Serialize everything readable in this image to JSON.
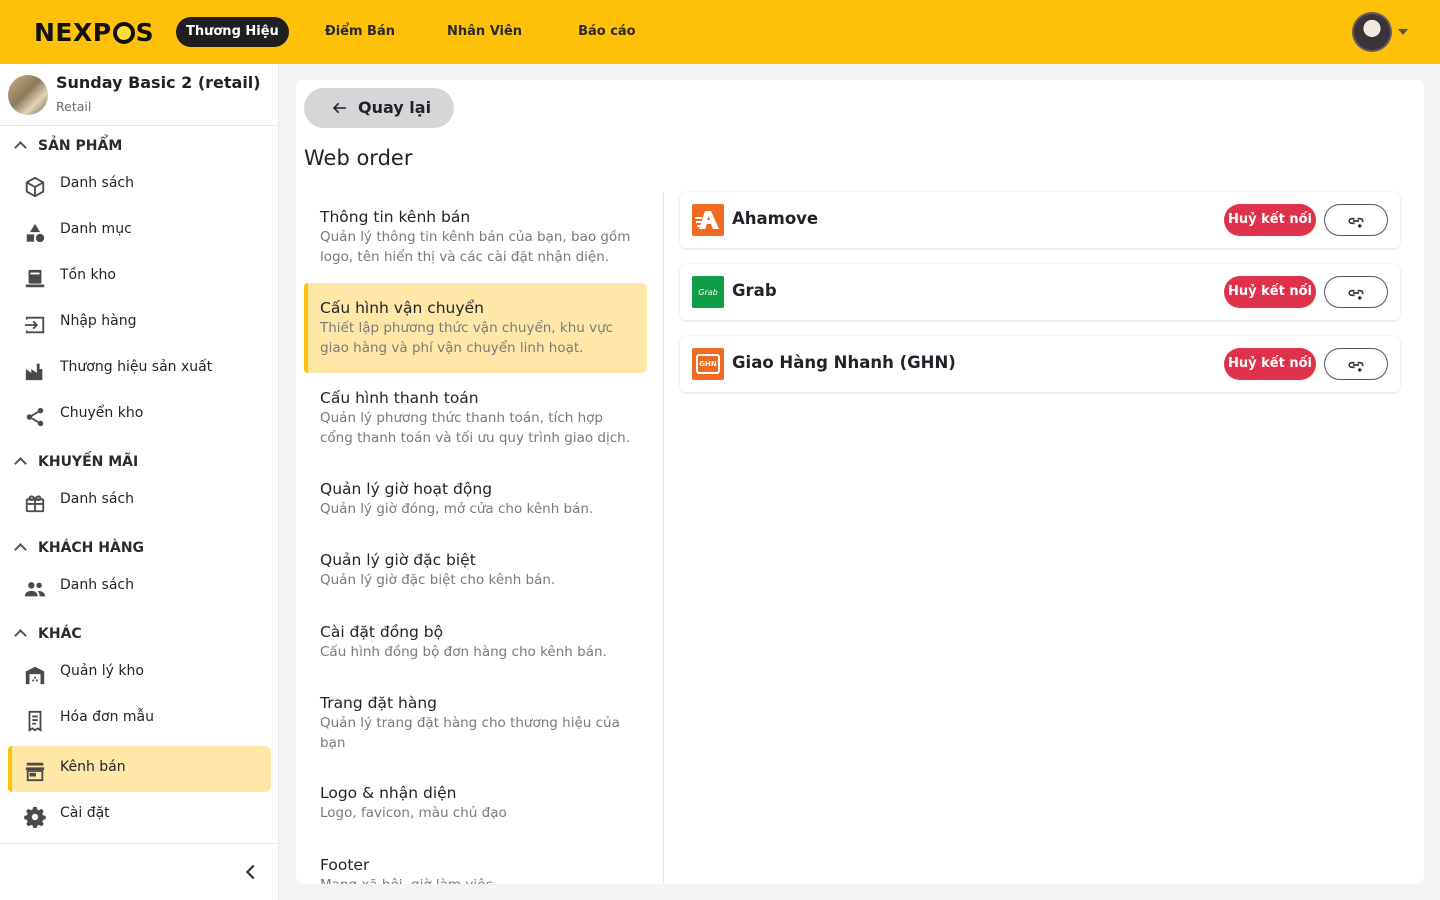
{
  "app": {
    "logo": "NEXPOS"
  },
  "topnav": {
    "items": [
      {
        "label": "Thương Hiệu",
        "active": true
      },
      {
        "label": "Điểm Bán",
        "active": false
      },
      {
        "label": "Nhân Viên",
        "active": false
      },
      {
        "label": "Báo cáo",
        "active": false
      }
    ]
  },
  "store": {
    "name": "Sunday Basic 2 (retail)",
    "type": "Retail"
  },
  "sidebar": {
    "sections": [
      {
        "label": "SẢN PHẨM",
        "items": [
          {
            "label": "Danh sách",
            "icon": "cube-icon"
          },
          {
            "label": "Danh mục",
            "icon": "category-icon"
          },
          {
            "label": "Tồn kho",
            "icon": "inventory-icon"
          },
          {
            "label": "Nhập hàng",
            "icon": "import-icon"
          },
          {
            "label": "Thương hiệu sản xuất",
            "icon": "factory-icon"
          },
          {
            "label": "Chuyển kho",
            "icon": "share-icon"
          }
        ]
      },
      {
        "label": "KHUYẾN MÃI",
        "items": [
          {
            "label": "Danh sách",
            "icon": "gift-icon"
          }
        ]
      },
      {
        "label": "KHÁCH HÀNG",
        "items": [
          {
            "label": "Danh sách",
            "icon": "people-icon"
          }
        ]
      },
      {
        "label": "KHÁC",
        "items": [
          {
            "label": "Quản lý kho",
            "icon": "warehouse-icon"
          },
          {
            "label": "Hóa đơn mẫu",
            "icon": "receipt-icon"
          },
          {
            "label": "Kênh bán",
            "icon": "storefront-icon",
            "active": true
          },
          {
            "label": "Cài đặt",
            "icon": "gear-icon"
          }
        ]
      }
    ]
  },
  "main": {
    "back_label": "Quay lại",
    "title": "Web order",
    "menu": [
      {
        "title": "Thông tin kênh bán",
        "desc": "Quản lý thông tin kênh bán của bạn, bao gồm logo, tên hiển thị và các cài đặt nhận diện."
      },
      {
        "title": "Cấu hình vận chuyển",
        "desc": "Thiết lập phương thức vận chuyển, khu vực giao hàng và phí vận chuyển linh hoạt.",
        "active": true
      },
      {
        "title": "Cấu hình thanh toán",
        "desc": "Quản lý phương thức thanh toán, tích hợp cổng thanh toán và tối ưu quy trình giao dịch."
      },
      {
        "title": "Quản lý giờ hoạt động",
        "desc": "Quản lý giờ đóng, mở cửa cho kênh bán."
      },
      {
        "title": "Quản lý giờ đặc biệt",
        "desc": "Quản lý giờ đặc biệt cho kênh bán."
      },
      {
        "title": "Cài đặt đồng bộ",
        "desc": "Cấu hình đồng bộ đơn hàng cho kênh bán."
      },
      {
        "title": "Trang đặt hàng",
        "desc": "Quản lý trang đặt hàng cho thương hiệu của bạn"
      },
      {
        "title": "Logo & nhận diện",
        "desc": "Logo, favicon, màu chủ đạo"
      },
      {
        "title": "Footer",
        "desc": "Mạng xã hội, giờ làm việc..."
      }
    ],
    "providers": [
      {
        "name": "Ahamove",
        "disconnect_label": "Huỷ kết nối",
        "color": "#f26a21"
      },
      {
        "name": "Grab",
        "disconnect_label": "Huỷ kết nối",
        "color": "#0f9d46",
        "logo_text": "Grab"
      },
      {
        "name": "Giao Hàng Nhanh (GHN)",
        "disconnect_label": "Huỷ kết nối",
        "color": "#f26a21",
        "logo_text": "GHN"
      }
    ]
  },
  "colors": {
    "brand": "#ffc107",
    "active_bg": "#ffe7a8",
    "danger": "#e0314b"
  }
}
